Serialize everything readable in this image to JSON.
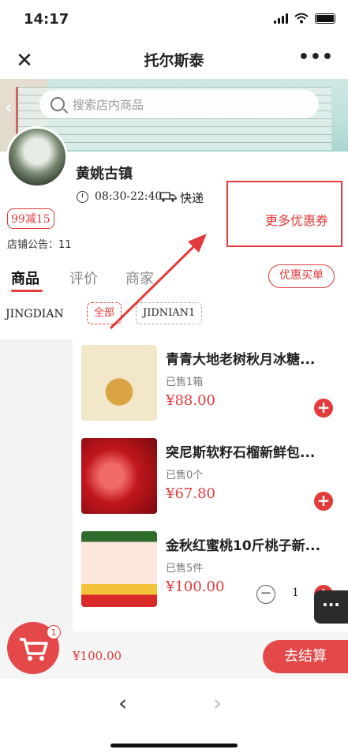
{
  "status": {
    "time": "14:17"
  },
  "window": {
    "title": "托尔斯泰"
  },
  "search": {
    "placeholder": "搜索店内商品"
  },
  "store": {
    "name": "黄姚古镇",
    "hours": "08:30-22:40",
    "delivery": "快递",
    "discount_tag": "99减15",
    "more_coupons": "更多优惠券",
    "notice": "店铺公告：11"
  },
  "tabs": [
    "商品",
    "评价",
    "商家"
  ],
  "pay_button": "优惠买单",
  "categories": {
    "side": "JINGDIAN",
    "chips": [
      "全部",
      "JIDNIAN1"
    ]
  },
  "products": [
    {
      "title": "青青大地老树秋月冰糖...",
      "sold": "已售1箱",
      "price": "¥88.00"
    },
    {
      "title": "突尼斯软籽石榴新鲜包...",
      "sold": "已售0个",
      "price": "¥67.80"
    },
    {
      "title": "金秋红蜜桃10斤桃子新...",
      "sold": "已售5件",
      "price": "¥100.00",
      "quantity": "1"
    }
  ],
  "cart": {
    "badge": "1",
    "total": "¥100.00",
    "checkout": "去结算"
  },
  "icons": {
    "close": "close-icon",
    "more": "more-icon",
    "search": "search-icon",
    "clock": "clock-icon",
    "truck": "truck-icon",
    "cart": "cart-icon",
    "back": "chevron-left-icon",
    "forward": "chevron-right-icon"
  },
  "colors": {
    "accent": "#e23b3b"
  }
}
